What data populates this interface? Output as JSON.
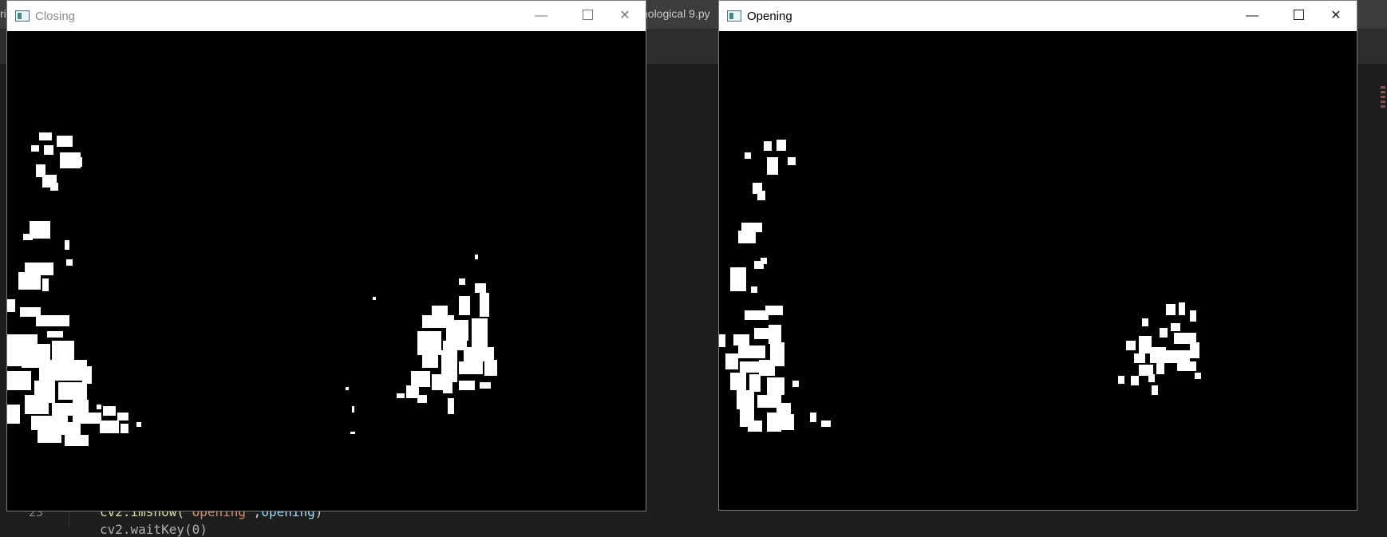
{
  "ide": {
    "title_fragment_left": "ri",
    "title_fragment_file": "nological 9.py",
    "line_numbers": [
      "23"
    ],
    "code_line": {
      "func": "cv2.imshow(",
      "str": "'Opening'",
      "sep": ",",
      "var": "opening",
      "end": ")"
    },
    "code_line_partial": "cv2.waitKey(0)"
  },
  "windows": {
    "closing": {
      "title": "Closing",
      "icon": "app-window-icon"
    },
    "opening": {
      "title": "Opening",
      "icon": "app-window-icon"
    }
  },
  "controls": {
    "minimize": "—",
    "close": "✕"
  },
  "colors": {
    "ide_background": "#1e1e1e",
    "ide_titlebar": "#3c3c3c",
    "window_titlebar": "#ffffff",
    "image_background": "#000000",
    "image_foreground": "#ffffff"
  }
}
